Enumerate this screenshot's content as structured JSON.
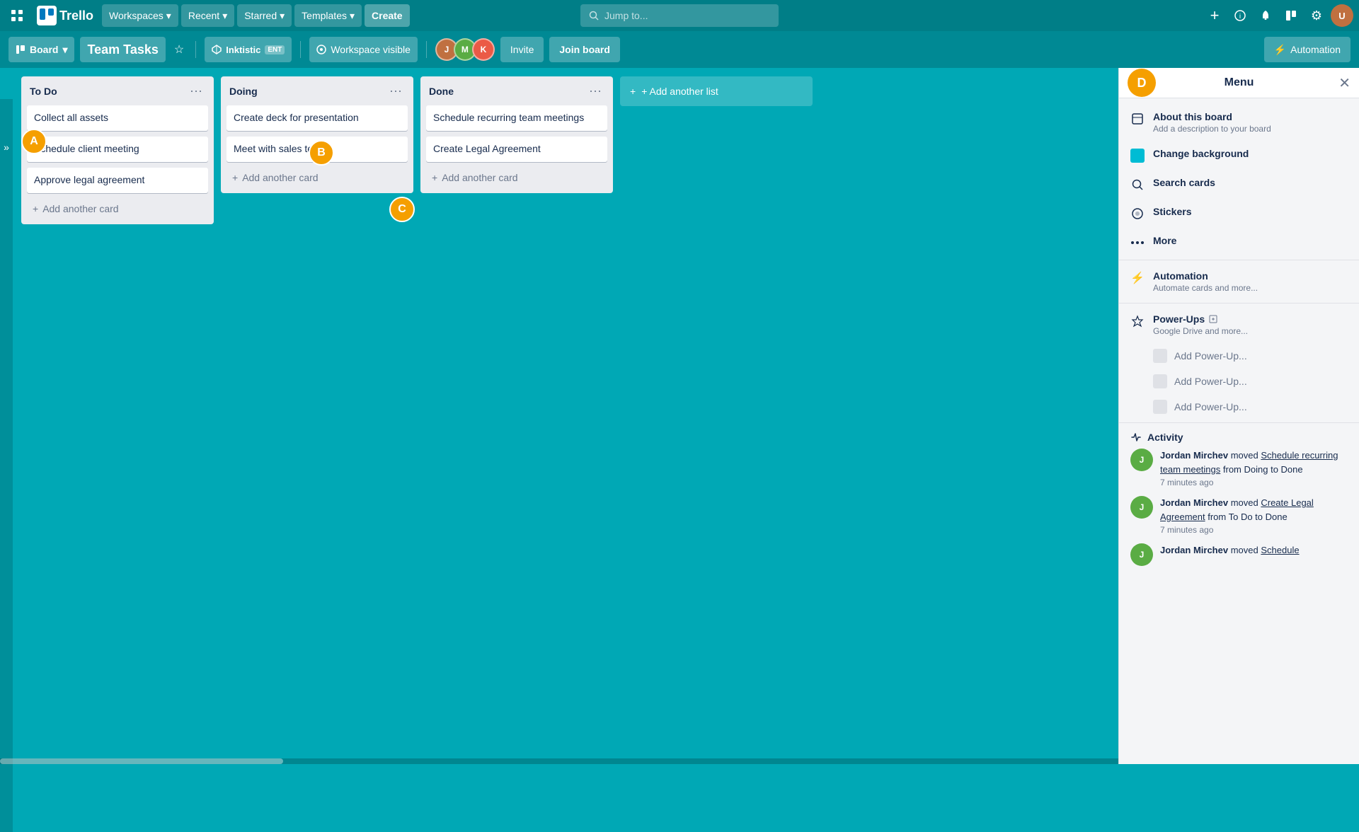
{
  "topNav": {
    "appSwitcher": "⊞",
    "trelloLabel": "Trello",
    "workspacesLabel": "Workspaces",
    "workspacesChevron": "▾",
    "recentLabel": "Recent",
    "starredLabel": "Starred",
    "templatesLabel": "Templates",
    "createLabel": "Create",
    "searchPlaceholder": "Jump to...",
    "plusIcon": "+",
    "infoIcon": "?",
    "bellIcon": "🔔",
    "boardIcon": "▦",
    "settingsIcon": "⚙",
    "userAvatarLabel": "User"
  },
  "boardHeader": {
    "boardLabel": "Board",
    "boardChevron": "▾",
    "boardName": "Team Tasks",
    "starLabel": "☆",
    "workspaceName": "Inktistic",
    "workspacePlan": "ENT",
    "workspaceVisibleLabel": "Workspace visible",
    "inviteLabel": "Invite",
    "joinBoardLabel": "Join board",
    "automationLabel": "Automation",
    "automationIcon": "⚡"
  },
  "lists": [
    {
      "id": "todo",
      "title": "To Do",
      "cards": [
        {
          "text": "Collect all assets"
        },
        {
          "text": "Schedule client meeting"
        },
        {
          "text": "Approve legal agreement"
        }
      ],
      "addCardLabel": "Add another card"
    },
    {
      "id": "doing",
      "title": "Doing",
      "cards": [
        {
          "text": "Create deck for presentation"
        },
        {
          "text": "Meet with sales team"
        }
      ],
      "addCardLabel": "Add another card"
    },
    {
      "id": "done",
      "title": "Done",
      "cards": [
        {
          "text": "Schedule recurring team meetings"
        },
        {
          "text": "Create Legal Agreement"
        }
      ],
      "addCardLabel": "Add another card"
    }
  ],
  "addListLabel": "+ Add another list",
  "menu": {
    "title": "Menu",
    "closeIcon": "✕",
    "userInitial": "D",
    "items": [
      {
        "icon": "book",
        "title": "About this board",
        "subtitle": "Add a description to your board"
      },
      {
        "icon": "teal-square",
        "title": "Change background",
        "subtitle": ""
      },
      {
        "icon": "search",
        "title": "Search cards",
        "subtitle": ""
      },
      {
        "icon": "sticker",
        "title": "Stickers",
        "subtitle": ""
      },
      {
        "icon": "more",
        "title": "More",
        "subtitle": ""
      }
    ],
    "automationSection": {
      "icon": "⚡",
      "title": "Automation",
      "subtitle": "Automate cards and more..."
    },
    "powerUpsSection": {
      "icon": "🚀",
      "title": "Power-Ups",
      "subtitle": "Google Drive and more...",
      "addItems": [
        "Add Power-Up...",
        "Add Power-Up...",
        "Add Power-Up..."
      ]
    },
    "activitySection": {
      "title": "Activity",
      "items": [
        {
          "user": "Jordan Mirchev",
          "action": "moved",
          "cardText": "Schedule recurring team meetings",
          "detail": "from Doing to Done",
          "time": "7 minutes ago"
        },
        {
          "user": "Jordan Mirchev",
          "action": "moved",
          "cardText": "Create Legal Agreement",
          "detail": "from To Do to Done",
          "time": "7 minutes ago"
        },
        {
          "user": "Jordan Mirchev",
          "action": "moved",
          "cardText": "Schedule",
          "detail": "",
          "time": ""
        }
      ]
    }
  },
  "annotations": {
    "a": "A",
    "b": "B",
    "c": "C"
  },
  "colors": {
    "background": "#00a8b5",
    "tealAccent": "#00bcd4",
    "orange": "#f59f00",
    "headerBg": "rgba(0,0,0,0.18)"
  }
}
